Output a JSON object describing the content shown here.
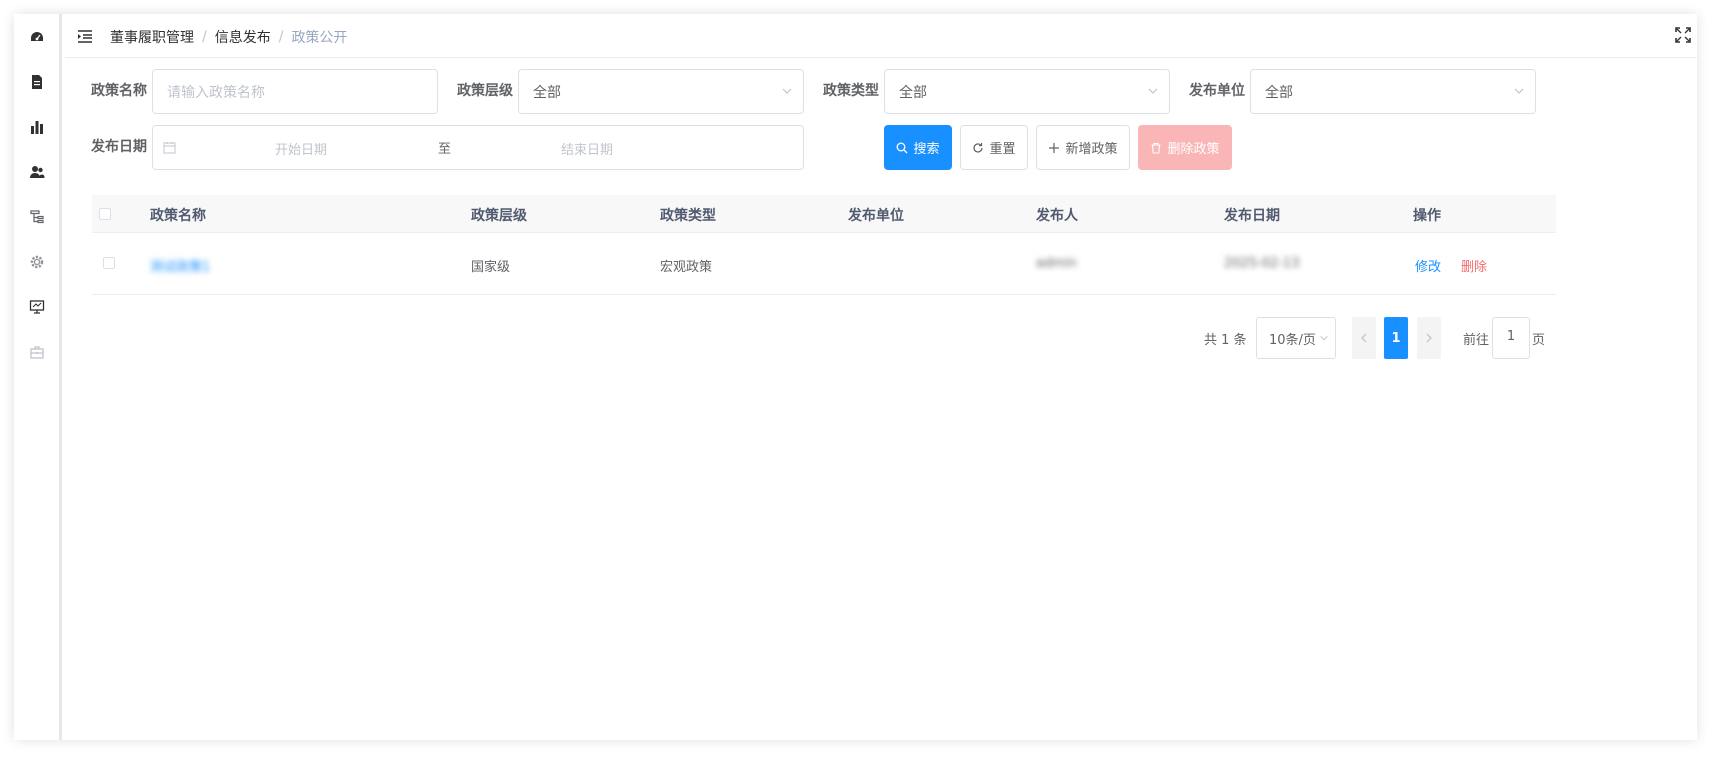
{
  "sidebar": {
    "icons": [
      "dashboard-icon",
      "document-icon",
      "bar-chart-icon",
      "users-icon",
      "tree-icon",
      "gear-icon",
      "monitor-icon",
      "toolbox-icon"
    ]
  },
  "navbar": {
    "breadcrumb": [
      "董事履职管理",
      "信息发布",
      "政策公开"
    ],
    "separator": "/"
  },
  "filters": {
    "policy_name": {
      "label": "政策名称",
      "placeholder": "请输入政策名称"
    },
    "policy_level": {
      "label": "政策层级",
      "value": "全部"
    },
    "policy_type": {
      "label": "政策类型",
      "value": "全部"
    },
    "publish_unit": {
      "label": "发布单位",
      "value": "全部"
    },
    "publish_date": {
      "label": "发布日期",
      "start_placeholder": "开始日期",
      "separator": "至",
      "end_placeholder": "结束日期"
    }
  },
  "actions": {
    "search": "搜索",
    "reset": "重置",
    "add": "新增政策",
    "delete": "删除政策"
  },
  "table": {
    "columns": [
      "政策名称",
      "政策层级",
      "政策类型",
      "发布单位",
      "发布人",
      "发布日期",
      "操作"
    ],
    "rows": [
      {
        "name": "测试政策1",
        "level": "国家级",
        "type": "宏观政策",
        "unit": "",
        "publisher": "admin",
        "date": "2025-02-13",
        "edit": "修改",
        "remove": "删除"
      }
    ]
  },
  "pagination": {
    "total": "共 1 条",
    "page_size": "10条/页",
    "current_page": "1",
    "goto_label": "前往",
    "goto_value": "1",
    "page_suffix": "页"
  },
  "colors": {
    "primary": "#1890ff",
    "danger_disabled": "#fab6b6",
    "danger_text": "#f56c6c",
    "breadcrumb_last": "#97a8be"
  }
}
